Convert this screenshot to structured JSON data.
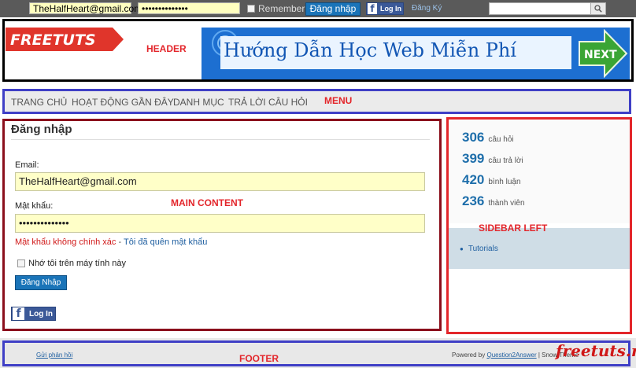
{
  "topbar": {
    "email_value": "TheHalfHeart@gmail.com",
    "password_value": "••••••••••••••",
    "remember_label": "Remember",
    "login_button": "Đăng nhập",
    "fb_login": "Log In",
    "register_link": "Đăng Ký",
    "search_placeholder": ""
  },
  "header": {
    "logo_text": "FREETUTS",
    "annotation": "HEADER",
    "banner_text": "Hướng Dẫn Học Web Miễn Phí",
    "next_label": "NEXT"
  },
  "menu": {
    "items": [
      "TRANG CHỦ",
      "HOẠT ĐỘNG GẦN ĐÂY",
      "DANH MỤC",
      "TRẢ LỜI CÂU HỎI"
    ],
    "annotation": "MENU"
  },
  "main": {
    "title": "Đăng nhập",
    "annotation": "MAIN CONTENT",
    "email_label": "Email:",
    "email_value": "TheHalfHeart@gmail.com",
    "password_label": "Mật khẩu:",
    "password_value": "••••••••••••••",
    "error_text": "Mật khẩu không chính xác",
    "error_sep": " - ",
    "forgot_link": "Tôi đã quên mật khẩu",
    "remember_label": "Nhớ tôi trên máy tính này",
    "submit_label": "Đăng Nhập",
    "fb_login": "Log In"
  },
  "sidebar": {
    "annotation": "SIDEBAR LEFT",
    "stats": [
      {
        "num": "306",
        "label": "câu hỏi"
      },
      {
        "num": "399",
        "label": "câu trả lời"
      },
      {
        "num": "420",
        "label": "bình luận"
      },
      {
        "num": "236",
        "label": "thành viên"
      }
    ],
    "categories": [
      "Tutorials"
    ]
  },
  "footer": {
    "feedback": "Gửi phản hồi",
    "annotation": "FOOTER",
    "powered_prefix": "Powered by ",
    "powered_link": "Question2Answer",
    "powered_suffix": " | Snow Theme",
    "watermark": "freetuts.net"
  },
  "colors": {
    "annotation_red": "#e3262b",
    "link_blue": "#1f5fa0",
    "button_blue": "#1a74b8",
    "field_yellow": "#ffffc8",
    "header_border": "#000000",
    "menu_border": "#3f3fc6",
    "main_border": "#8b0f1c",
    "sidebar_border": "#e3262b",
    "footer_border": "#3f3fc6"
  }
}
